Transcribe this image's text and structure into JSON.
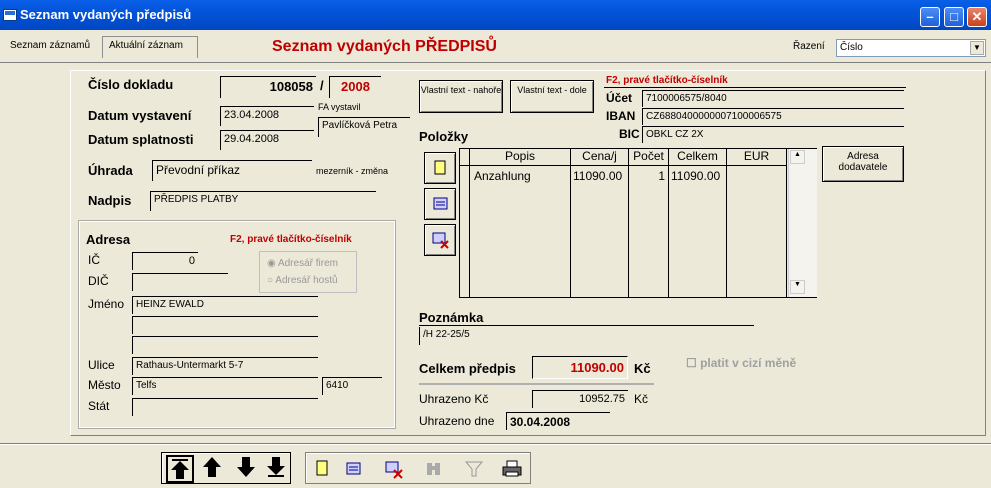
{
  "window": {
    "title": "Seznam vydaných předpisů"
  },
  "tabs": [
    {
      "label": "Seznam záznamů"
    },
    {
      "label": "Aktuální záznam"
    }
  ],
  "header": {
    "title": "Seznam vydaných PŘEDPISŮ",
    "sort_label": "Řazení",
    "sort_value": "Číslo"
  },
  "doc": {
    "number_label": "Číslo dokladu",
    "number": "108058",
    "slash": "/",
    "year": "2008",
    "issued_label": "Datum vystavení",
    "issued": "23.04.2008",
    "issued_by_label": "FA vystavil",
    "issued_by": "Pavlíčková Petra",
    "due_label": "Datum splatnosti",
    "due": "29.04.2008",
    "payment_label": "Úhrada",
    "payment": "Převodní příkaz",
    "payment_note": "mezerník - změna",
    "heading_label": "Nadpis",
    "heading": "PŘEDPIS PLATBY"
  },
  "address": {
    "title": "Adresa",
    "hint": "F2, pravé tlačítko-číselník",
    "ic_label": "IČ",
    "ic": "0",
    "dic_label": "DIČ",
    "dic": "",
    "radio_firms": "Adresář firem",
    "radio_guests": "Adresář hostů",
    "name_label": "Jméno",
    "name": "HEINZ EWALD",
    "name2": "",
    "name3": "",
    "street_label": "Ulice",
    "street": "Rathaus-Untermarkt 5-7",
    "city_label": "Město",
    "city": "Telfs",
    "zip": "6410",
    "country_label": "Stát",
    "country": ""
  },
  "buttons": {
    "text_top": "Vlastní text - nahoře",
    "text_bottom": "Vlastní text - dole",
    "supplier_address": "Adresa dodavatele"
  },
  "bank": {
    "hint": "F2, pravé tlačítko-číselník",
    "account_label": "Účet",
    "account": "7100006575/8040",
    "iban_label": "IBAN",
    "iban": "CZ6880400000007100006575",
    "bic_label": "BIC",
    "bic": "OBKL CZ 2X"
  },
  "items": {
    "title": "Položky",
    "columns": [
      "Popis",
      "Cena/j",
      "Počet",
      "Celkem",
      "EUR"
    ],
    "rows": [
      {
        "popis": "Anzahlung",
        "cena": "11090.00",
        "pocet": "1",
        "celkem": "11090.00",
        "eur": ""
      }
    ]
  },
  "note": {
    "label": "Poznámka",
    "value": "/H 22-25/5"
  },
  "totals": {
    "total_label": "Celkem předpis",
    "total": "11090.00",
    "currency": "Kč",
    "foreign_label": "platit v cizí měně",
    "paid_label": "Uhrazeno Kč",
    "paid": "10952.75",
    "paid_currency": "Kč",
    "paid_date_label": "Uhrazeno dne",
    "paid_date": "30.04.2008"
  }
}
